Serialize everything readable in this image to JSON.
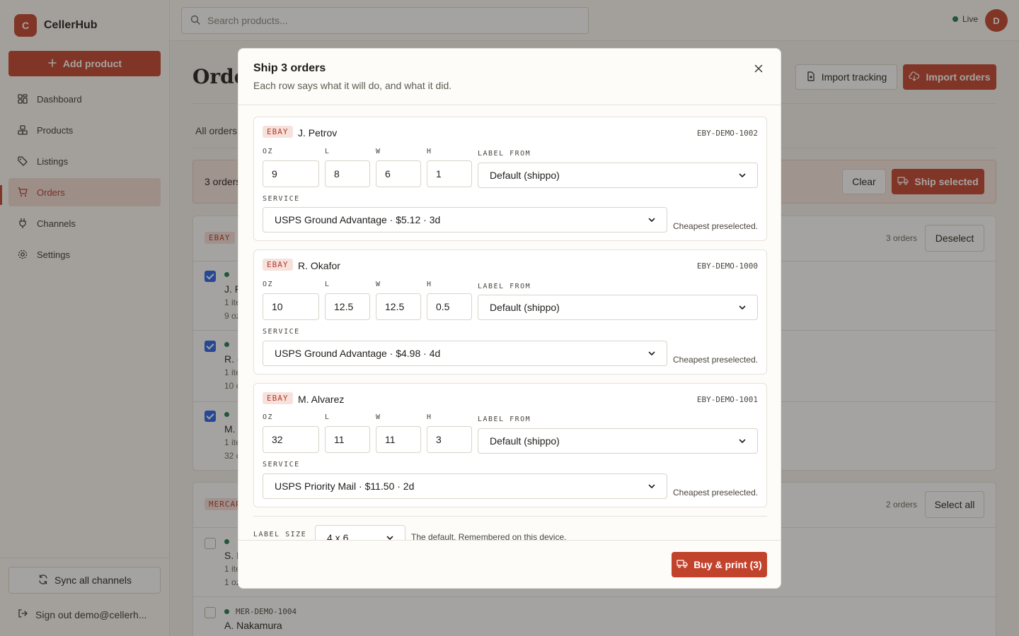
{
  "app": {
    "name": "CellerHub",
    "logo_letter": "C"
  },
  "sidebar": {
    "add_product": "Add product",
    "items": [
      {
        "label": "Dashboard",
        "icon": "grid-icon"
      },
      {
        "label": "Products",
        "icon": "boxes-icon"
      },
      {
        "label": "Listings",
        "icon": "tag-icon"
      },
      {
        "label": "Orders",
        "icon": "cart-icon",
        "active": true
      },
      {
        "label": "Channels",
        "icon": "plug-icon"
      },
      {
        "label": "Settings",
        "icon": "gear-icon"
      }
    ],
    "sync": "Sync all channels",
    "signout": "Sign out demo@cellerh..."
  },
  "topbar": {
    "search_placeholder": "Search products...",
    "status": "Live",
    "avatar_letter": "D"
  },
  "main": {
    "title": "Orde",
    "import_tracking": "Import tracking",
    "import_orders": "Import orders",
    "tab_all": "All orders",
    "selection_count": "3 orders",
    "clear": "Clear",
    "ship_selected": "Ship selected",
    "groups": [
      {
        "tag": "EBAY",
        "count": "3 orders",
        "action": "Deselect",
        "rows": [
          {
            "checked": true,
            "name": "J. F",
            "line1": "1 ite",
            "line2": "9 oz"
          },
          {
            "checked": true,
            "name": "R. (",
            "line1": "1 ite",
            "line2": "10 c"
          },
          {
            "checked": true,
            "name": "M.",
            "line1": "1 ite",
            "line2": "32 c"
          }
        ]
      },
      {
        "tag": "MERCAR",
        "count": "2 orders",
        "action": "Select all",
        "rows": [
          {
            "checked": false,
            "name": "S. I",
            "line1": "1 ite",
            "line2": "1 oz"
          },
          {
            "checked": false,
            "id": "MER-DEMO-1004",
            "name": "A. Nakamura"
          }
        ]
      }
    ]
  },
  "modal": {
    "title": "Ship 3 orders",
    "subtitle": "Each row says what it will do, and what it did.",
    "labels": {
      "oz": "OZ",
      "l": "L",
      "w": "W",
      "h": "H",
      "label_from": "LABEL FROM",
      "service": "SERVICE",
      "label_size": "LABEL SIZE"
    },
    "orders": [
      {
        "channel": "EBAY",
        "customer": "J. Petrov",
        "order_id": "EBY-DEMO-1002",
        "oz": "9",
        "l": "8",
        "w": "6",
        "h": "1",
        "label_from": "Default (shippo)",
        "service": "USPS Ground Advantage · $5.12 · 3d",
        "hint": "Cheapest preselected."
      },
      {
        "channel": "EBAY",
        "customer": "R. Okafor",
        "order_id": "EBY-DEMO-1000",
        "oz": "10",
        "l": "12.5",
        "w": "12.5",
        "h": "0.5",
        "label_from": "Default (shippo)",
        "service": "USPS Ground Advantage · $4.98 · 4d",
        "hint": "Cheapest preselected."
      },
      {
        "channel": "EBAY",
        "customer": "M. Alvarez",
        "order_id": "EBY-DEMO-1001",
        "oz": "32",
        "l": "11",
        "w": "11",
        "h": "3",
        "label_from": "Default (shippo)",
        "service": "USPS Priority Mail · $11.50 · 2d",
        "hint": "Cheapest preselected."
      }
    ],
    "label_size_value": "4 x 6",
    "label_size_hint": "The default. Remembered on this device.",
    "buy_print": "Buy & print (3)"
  },
  "colors": {
    "accent": "#c2432c",
    "status_live": "#1f7a4f",
    "checkbox": "#2563eb"
  }
}
